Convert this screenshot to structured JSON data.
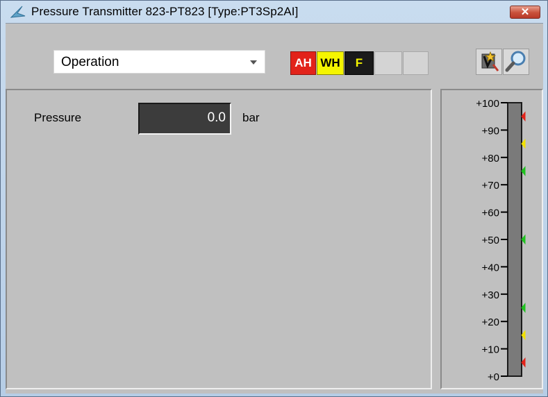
{
  "window": {
    "title": "Pressure Transmitter 823-PT823  [Type:PT3Sp2AI]",
    "close_label": "✕"
  },
  "toolbar": {
    "view_selector": {
      "selected": "Operation"
    },
    "alarm_badges": [
      {
        "label": "AH",
        "color": "#e2231a",
        "text_color": "#ffffff"
      },
      {
        "label": "WH",
        "color": "#f5f500",
        "text_color": "#000000"
      },
      {
        "label": "F",
        "color": "#1a1a1a",
        "text_color": "#f5f500"
      },
      {
        "label": "",
        "color": "#d4d4d4"
      },
      {
        "label": "",
        "color": "#d4d4d4"
      }
    ],
    "tools": [
      {
        "icon": "settings-wand-icon"
      },
      {
        "icon": "magnifier-icon"
      }
    ]
  },
  "measurement": {
    "label": "Pressure",
    "value": "0.0",
    "unit": "bar"
  },
  "scale": {
    "min": 0,
    "max": 100,
    "current_value": 0,
    "tick_labels": [
      "+100",
      "+90",
      "+80",
      "+70",
      "+60",
      "+50",
      "+40",
      "+30",
      "+20",
      "+10",
      "+0"
    ],
    "markers": [
      {
        "value": 95,
        "color": "#e2231a"
      },
      {
        "value": 85,
        "color": "#f0e000"
      },
      {
        "value": 75,
        "color": "#1fc21f"
      },
      {
        "value": 50,
        "color": "#1fc21f"
      },
      {
        "value": 25,
        "color": "#1fc21f"
      },
      {
        "value": 15,
        "color": "#f0e000"
      },
      {
        "value": 5,
        "color": "#e2231a"
      }
    ]
  }
}
